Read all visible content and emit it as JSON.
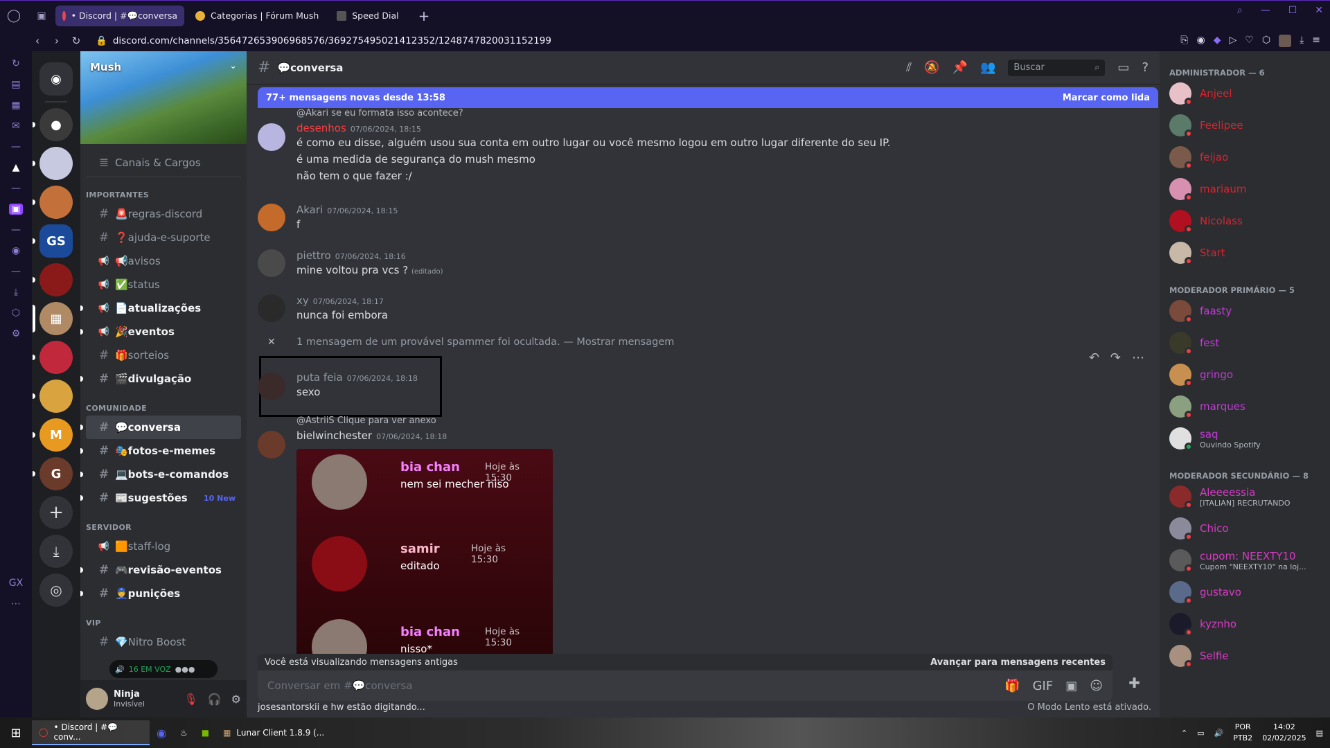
{
  "browser": {
    "tabs": [
      {
        "label": "• Discord | #💬conversa",
        "color": "#e8464d"
      },
      {
        "label": "Categorias | Fórum Mush",
        "color": "#e8b23a"
      },
      {
        "label": "Speed Dial",
        "color": "#9a9a9a"
      }
    ],
    "url": "discord.com/channels/356472653906968576/369275495021412352/1248747820031152199"
  },
  "server": {
    "name": "Mush"
  },
  "sidebar_top": {
    "label": "Canais & Cargos"
  },
  "channel_groups": [
    {
      "category": "IMPORTANTES",
      "channels": [
        {
          "name": "🚨regras-discord",
          "state": "read"
        },
        {
          "name": "❓ajuda-e-suporte",
          "state": "read"
        },
        {
          "name": "📢avisos",
          "state": "read"
        },
        {
          "name": "✅status",
          "state": "read"
        },
        {
          "name": "📄atualizações",
          "state": "unread"
        },
        {
          "name": "🎉eventos",
          "state": "unread"
        },
        {
          "name": "🎁sorteios",
          "state": "read"
        },
        {
          "name": "🎬divulgação",
          "state": "unread"
        }
      ]
    },
    {
      "category": "COMUNIDADE",
      "channels": [
        {
          "name": "💬conversa",
          "state": "selected"
        },
        {
          "name": "🎭fotos-e-memes",
          "state": "unread"
        },
        {
          "name": "💻bots-e-comandos",
          "state": "unread"
        },
        {
          "name": "📰sugestões",
          "state": "unread",
          "badge": "10 New"
        }
      ]
    },
    {
      "category": "SERVIDOR",
      "channels": [
        {
          "name": "🟧staff-log",
          "state": "read"
        },
        {
          "name": "🎮revisão-eventos",
          "state": "unread"
        },
        {
          "name": "👮punições",
          "state": "unread"
        }
      ]
    },
    {
      "category": "VIP",
      "channels": [
        {
          "name": "💎Nitro Boost",
          "state": "read"
        }
      ]
    }
  ],
  "voice": {
    "label": "16 EM VOZ"
  },
  "user": {
    "name": "Ninja",
    "status": "Invisível"
  },
  "chat": {
    "channel": "💬conversa",
    "search_placeholder": "Buscar",
    "new_bar": {
      "text": "77+ mensagens novas desde 13:58",
      "action": "Marcar como lida"
    },
    "messages": [
      {
        "reply": "@Akari se eu formata isso acontece?",
        "author": "desenhos",
        "color": "#f23f43",
        "time": "07/06/2024, 18:15",
        "lines": [
          "é como eu disse, alguém usou sua conta em outro lugar ou você mesmo logou em outro lugar diferente do seu IP.",
          "é uma medida de segurança do mush mesmo",
          "não tem o que fazer :/"
        ]
      },
      {
        "author": "Akari",
        "color": "#949ba4",
        "time": "07/06/2024, 18:15",
        "lines": [
          "f"
        ]
      },
      {
        "author": "piettro",
        "color": "#949ba4",
        "time": "07/06/2024, 18:16",
        "lines": [
          "mine voltou pra vcs ?"
        ],
        "edited": "(editado)"
      },
      {
        "author": "xy",
        "color": "#949ba4",
        "time": "07/06/2024, 18:17",
        "lines": [
          "nunca foi embora"
        ]
      },
      {
        "author": "puta feia",
        "color": "#949ba4",
        "time": "07/06/2024, 18:18",
        "lines": [
          "sexo"
        ]
      },
      {
        "reply": "@AstriiS Clique para ver anexo",
        "author": "bielwinchester",
        "color": "#dbdee1",
        "time": "07/06/2024, 18:18",
        "lines": []
      }
    ],
    "hidden": "1 mensagem de um provável spammer foi ocultada. — Mostrar mensagem",
    "embed": [
      {
        "name": "bia chan",
        "color": "#f47fff",
        "time": "Hoje às 15:30",
        "text": "nem sei mecher niso"
      },
      {
        "name": "samir",
        "color": "#f9b8c9",
        "time": "Hoje às 15:30",
        "text": "editado"
      },
      {
        "name": "bia chan",
        "color": "#f47fff",
        "time": "Hoje às 15:30",
        "text": "nisso*"
      }
    ],
    "old_bar": {
      "text": "Você está visualizando mensagens antigas",
      "jump": "Avançar para mensagens recentes"
    },
    "composer_placeholder": "Conversar em #💬conversa",
    "typing": "josesantorskii e hw estão digitando...",
    "slowmode": "O Modo Lento está ativado."
  },
  "members": [
    {
      "category": "ADMINISTRADOR — 6",
      "items": [
        {
          "name": "Anjeel",
          "color": "#d9232f"
        },
        {
          "name": "Feelipee",
          "color": "#d9232f"
        },
        {
          "name": "feijao",
          "color": "#d9232f"
        },
        {
          "name": "mariaum",
          "color": "#d9232f"
        },
        {
          "name": "Nicolass",
          "color": "#d9232f"
        },
        {
          "name": "Start",
          "color": "#d9232f"
        }
      ]
    },
    {
      "category": "MODERADOR PRIMÁRIO — 5",
      "items": [
        {
          "name": "faasty",
          "color": "#c13bd6"
        },
        {
          "name": "fest",
          "color": "#c13bd6"
        },
        {
          "name": "gringo",
          "color": "#c13bd6"
        },
        {
          "name": "marques",
          "color": "#c13bd6"
        },
        {
          "name": "saq",
          "color": "#c13bd6",
          "sub": "Ouvindo Spotify"
        }
      ]
    },
    {
      "category": "MODERADOR SECUNDÁRIO — 8",
      "items": [
        {
          "name": "Aleeeessia",
          "color": "#d63bc3",
          "sub": "[ITALIAN] RECRUTANDO"
        },
        {
          "name": "Chico",
          "color": "#d63bc3"
        },
        {
          "name": "cupom: NEEXTY10",
          "color": "#d63bc3",
          "sub": "Cupom \"NEEXTY10\" na loj..."
        },
        {
          "name": "gustavo",
          "color": "#d63bc3"
        },
        {
          "name": "kyznho",
          "color": "#d63bc3"
        },
        {
          "name": "Selfie",
          "color": "#d63bc3"
        }
      ]
    }
  ],
  "taskbar": {
    "items": [
      "• Discord | #💬conv...",
      "Lunar Client 1.8.9 (..."
    ],
    "lang": "POR",
    "layout": "PTB2",
    "time": "14:02",
    "date": "02/02/2025"
  }
}
